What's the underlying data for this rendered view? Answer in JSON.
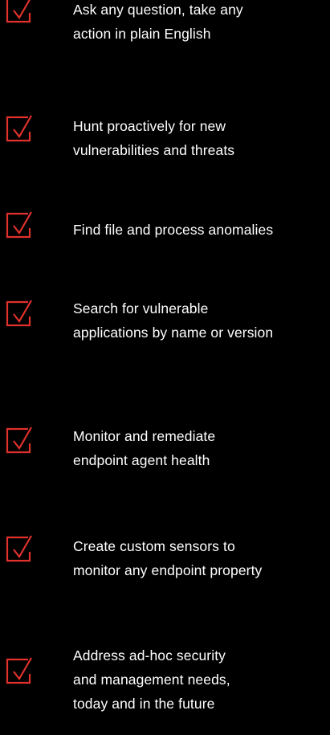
{
  "colors": {
    "background": "#000000",
    "text": "#ffffff",
    "accent": "#e0312c"
  },
  "features": [
    {
      "icon": "checkbox-check-icon",
      "lines": [
        "Ask any question, take any",
        "action in plain English"
      ]
    },
    {
      "icon": "checkbox-check-icon",
      "lines": [
        "Hunt proactively for new",
        "vulnerabilities and threats"
      ]
    },
    {
      "icon": "checkbox-check-icon",
      "lines": [
        "Find file and process anomalies"
      ]
    },
    {
      "icon": "checkbox-check-icon",
      "lines": [
        "Search for vulnerable",
        "applications by name or version"
      ]
    },
    {
      "icon": "checkbox-check-icon",
      "lines": [
        "Monitor and remediate",
        "endpoint agent health"
      ]
    },
    {
      "icon": "checkbox-check-icon",
      "lines": [
        "Create custom sensors to",
        "monitor any endpoint property"
      ]
    },
    {
      "icon": "checkbox-check-icon",
      "lines": [
        "Address ad-hoc security",
        "and management needs,",
        "today and in the future"
      ]
    }
  ]
}
